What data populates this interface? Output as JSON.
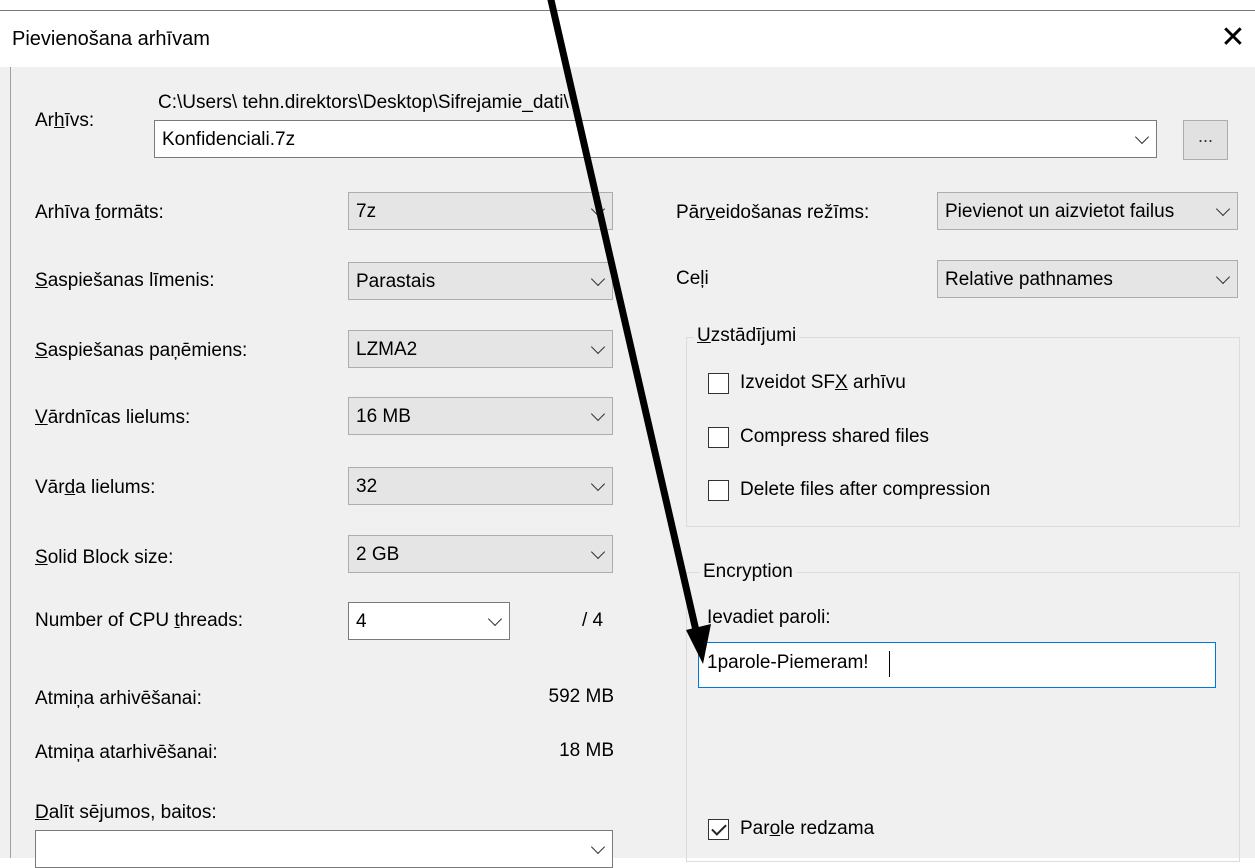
{
  "dialog": {
    "title": "Pievienošana arhīvam",
    "close_glyph": "✕"
  },
  "archive": {
    "label_pre": "Ar",
    "label_ul": "h",
    "label_post": "īvs:",
    "path": "C:\\Users\\ tehn.direktors\\Desktop\\Sifrejamie_dati\\",
    "filename": "Konfidenciali.7z",
    "browse_label": "..."
  },
  "left": {
    "format": {
      "pre": "Arhīva ",
      "ul": "f",
      "post": "ormāts:",
      "value": "7z"
    },
    "level": {
      "pre": "",
      "ul": "S",
      "post": "aspiešanas līmenis:",
      "value": "Parastais"
    },
    "method": {
      "pre": "",
      "ul": "S",
      "post": "aspiešanas paņēmiens:",
      "value": "LZMA2"
    },
    "dict": {
      "pre": "",
      "ul": "V",
      "post": "ārdnīcas lielums:",
      "value": "16 MB"
    },
    "word": {
      "pre": "Vār",
      "ul": "d",
      "post": "a lielums:",
      "value": "32"
    },
    "solid": {
      "pre": "",
      "ul": "S",
      "post": "olid Block size:",
      "value": "2 GB"
    },
    "threads": {
      "pre": "Number of CPU ",
      "ul": "t",
      "post": "hreads:",
      "value": "4",
      "max": "/ 4"
    },
    "mem_compress": {
      "label": "Atmiņa arhivēšanai:",
      "value": "592 MB"
    },
    "mem_decompress": {
      "label": "Atmiņa atarhivēšanai:",
      "value": "18 MB"
    },
    "split": {
      "pre": "",
      "ul": "D",
      "post": "alīt sējumos, baitos:",
      "value": ""
    }
  },
  "right": {
    "update_mode": {
      "pre": "Pār",
      "ul": "v",
      "post": "eidošanas režīms:",
      "value": "Pievienot un aizvietot failus"
    },
    "paths": {
      "label": "Ceļi",
      "value": "Relative pathnames"
    },
    "options": {
      "title_ul": "U",
      "title_post": "zstādījumi",
      "sfx": {
        "pre": "Izveidot SF",
        "ul": "X",
        "post": " arhīvu",
        "checked": false
      },
      "shared": {
        "label": "Compress shared files",
        "checked": false
      },
      "delete": {
        "label": "Delete files after compression",
        "checked": false
      }
    },
    "encryption": {
      "title": "Encryption",
      "prompt": "Ievadiet paroli:",
      "password": "1parole-Piemeram!",
      "show": {
        "pre": "Par",
        "ul": "o",
        "post": "le redzama",
        "checked": true
      }
    }
  }
}
